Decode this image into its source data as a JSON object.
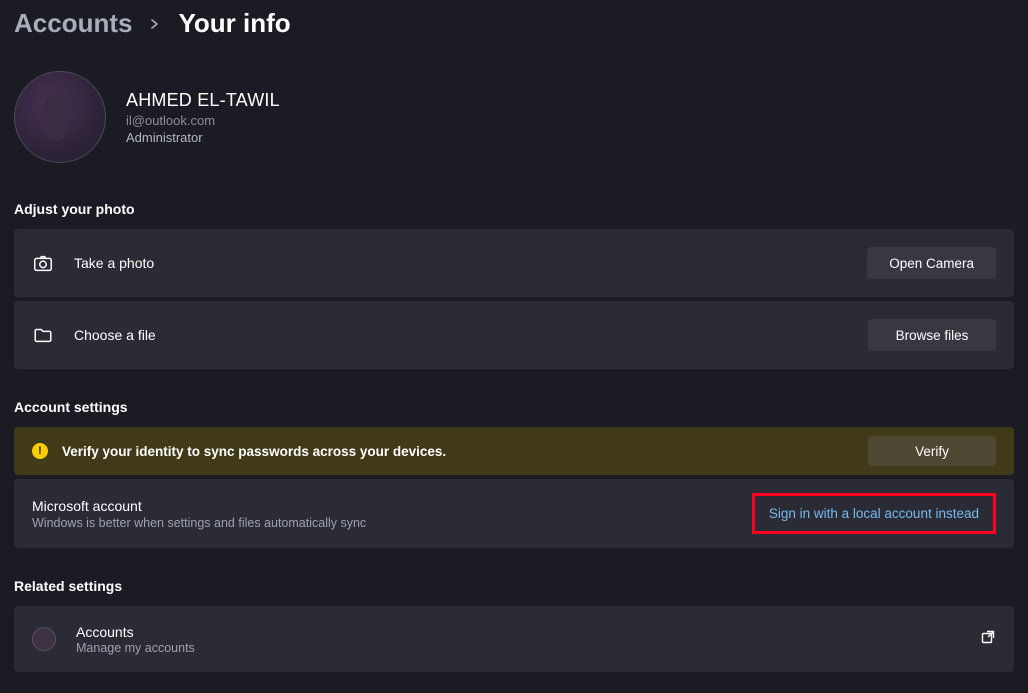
{
  "breadcrumb": {
    "parent": "Accounts",
    "current": "Your info"
  },
  "profile": {
    "name": "AHMED EL-TAWIL",
    "email": "il@outlook.com",
    "role": "Administrator"
  },
  "photo": {
    "section_title": "Adjust your photo",
    "take_label": "Take a photo",
    "take_button": "Open Camera",
    "choose_label": "Choose a file",
    "choose_button": "Browse files"
  },
  "account": {
    "section_title": "Account settings",
    "verify_warning": "Verify your identity to sync passwords across your devices.",
    "verify_button": "Verify",
    "ms_title": "Microsoft account",
    "ms_sub": "Windows is better when settings and files automatically sync",
    "local_link": "Sign in with a local account instead"
  },
  "related": {
    "section_title": "Related settings",
    "accounts_title": "Accounts",
    "accounts_sub": "Manage my accounts"
  }
}
